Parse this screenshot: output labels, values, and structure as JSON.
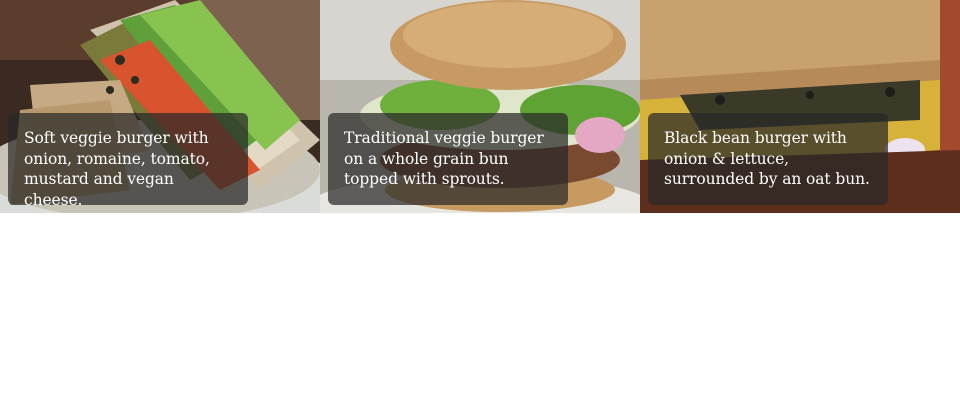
{
  "gallery": {
    "items": [
      {
        "caption": "Soft veggie burger with onion, romaine, tomato, mustard and vegan cheese.",
        "image": "sandwich-photo"
      },
      {
        "caption": "Traditional veggie burger on a whole grain bun topped with sprouts.",
        "image": "burger-sprouts-photo"
      },
      {
        "caption": "Black bean burger with onion & lettuce, surrounded by an oat bun.",
        "image": "black-bean-burger-photo"
      }
    ],
    "colors": {
      "caption_bg": "#282828",
      "caption_text": "#ffffff",
      "page_bg": "#ffffff"
    }
  }
}
